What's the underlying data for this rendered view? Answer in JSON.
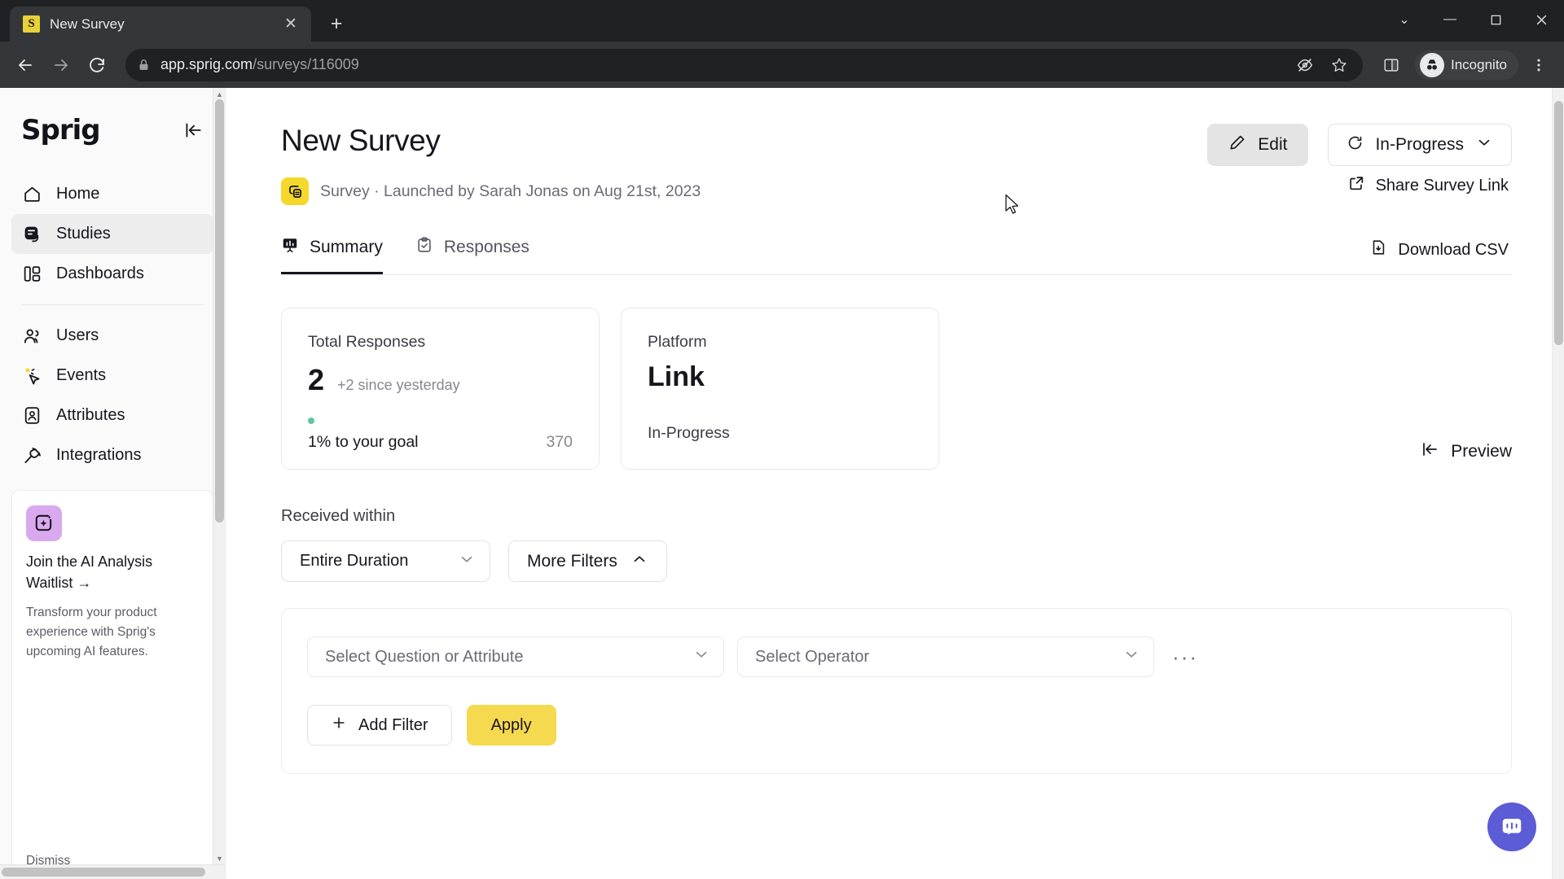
{
  "browser": {
    "tab": {
      "title": "New Survey",
      "favicon_letter": "S",
      "close_label": "✕"
    },
    "new_tab_label": "+",
    "window_controls": {
      "minimize": "—",
      "maximize": "❐",
      "close": "✕",
      "tablist": "⌄"
    },
    "omnibox": {
      "url_host": "app.sprig.com",
      "url_path": "/surveys/116009",
      "lock_icon": "lock-icon"
    },
    "profile": {
      "label": "Incognito"
    },
    "nav": {
      "back": "back-icon",
      "forward": "forward-icon",
      "reload": "reload-icon"
    },
    "toolbar_icons": [
      "tracking-protection-icon",
      "bookmark-star-icon",
      "side-panel-icon",
      "chrome-menu-icon"
    ]
  },
  "sidebar": {
    "logo": "Sprig",
    "collapse_label": "collapse-sidebar",
    "items": [
      {
        "label": "Home",
        "icon": "home-icon",
        "active": false
      },
      {
        "label": "Studies",
        "icon": "studies-icon",
        "active": true
      },
      {
        "label": "Dashboards",
        "icon": "dashboards-icon",
        "active": false
      },
      {
        "label": "Users",
        "icon": "users-icon",
        "active": false
      },
      {
        "label": "Events",
        "icon": "events-icon",
        "active": false
      },
      {
        "label": "Attributes",
        "icon": "attributes-icon",
        "active": false
      },
      {
        "label": "Integrations",
        "icon": "integrations-icon",
        "active": false
      }
    ],
    "promo": {
      "title": "Join the AI Analysis Waitlist →",
      "body": "Transform your product experience with Sprig's upcoming AI features.",
      "dismiss": "Dismiss",
      "badge_color": "#d9a8ef"
    }
  },
  "main": {
    "title": "New Survey",
    "subtitle": "Survey · Launched by Sarah Jonas on Aug 21st, 2023",
    "edit_button": "Edit",
    "status": "In-Progress",
    "share_link": "Share Survey Link",
    "tabs": [
      {
        "label": "Summary",
        "icon": "chart-presentation-icon",
        "active": true
      },
      {
        "label": "Responses",
        "icon": "clipboard-check-icon",
        "active": false
      }
    ],
    "download_csv": "Download CSV",
    "preview": "Preview",
    "cards": [
      {
        "label": "Total Responses",
        "value": "2",
        "delta": "+2 since yesterday",
        "progress_text": "1% to your goal",
        "goal": "370",
        "progress_percent": 1,
        "progress_color": "#5ec79e"
      },
      {
        "label": "Platform",
        "value": "Link",
        "status": "In-Progress"
      }
    ],
    "filters": {
      "received_within_label": "Received within",
      "duration_value": "Entire Duration",
      "more_filters": "More Filters",
      "question_placeholder": "Select Question or Attribute",
      "operator_placeholder": "Select Operator",
      "overflow": "···",
      "add_filter": "Add Filter",
      "apply": "Apply",
      "apply_color": "#f5d94f"
    }
  }
}
